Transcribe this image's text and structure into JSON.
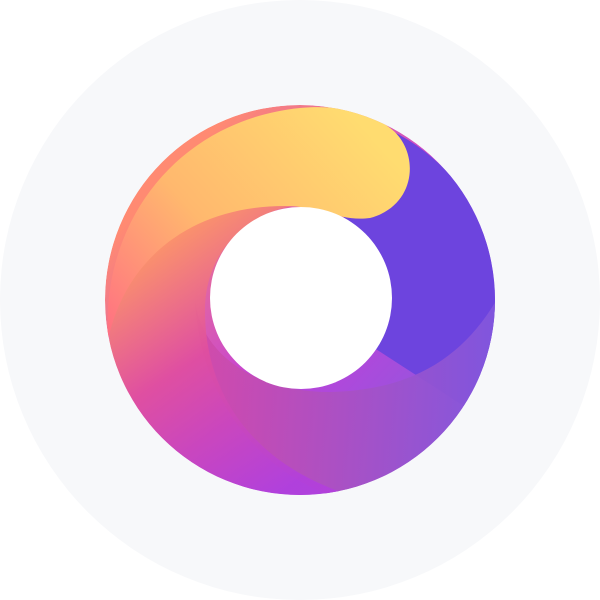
{
  "logo": {
    "icon": "swirl-ring-logo-icon",
    "background_color": "#f7f8fa",
    "colors": {
      "yellow": "#ffdc70",
      "orange": "#ff9e62",
      "coral": "#ff6e82",
      "magenta": "#c23fd8",
      "pink": "#e04e9f",
      "violet": "#6d44de",
      "lavender": "#8b5ae0",
      "hole": "#ffffff"
    }
  }
}
